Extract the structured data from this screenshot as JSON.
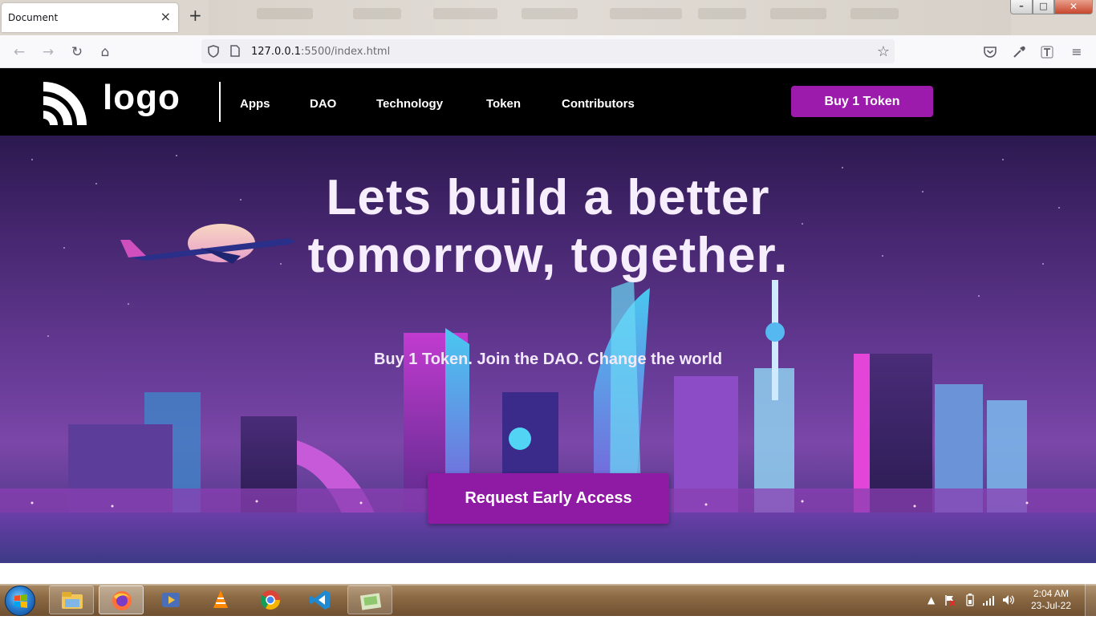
{
  "browser": {
    "tab_title": "Document",
    "tab_close": "×",
    "new_tab": "+",
    "url_host": "127.0.0.1",
    "url_rest": ":5500/index.html",
    "back": "←",
    "forward": "→",
    "reload": "↻",
    "home": "⌂",
    "star": "☆",
    "pocket": "♡",
    "menu": "≡",
    "window_min": "–",
    "window_max": "□",
    "window_close": "✕"
  },
  "site": {
    "logo_text": "logo",
    "nav": [
      "Apps",
      "DAO",
      "Technology",
      "Token",
      "Contributors"
    ],
    "buy_button": "Buy 1 Token",
    "hero_title_1": "Lets build a better",
    "hero_title_2": "tomorrow, together.",
    "hero_subtitle": "Buy 1 Token. Join the DAO. Change the world",
    "cta_button": "Request Early Access",
    "colors": {
      "accent": "#9c1bac",
      "header_bg": "#000000"
    }
  },
  "taskbar": {
    "time": "2:04 AM",
    "date": "23-Jul-22",
    "apps": [
      "file-explorer-icon",
      "firefox-icon",
      "media-player-icon",
      "vlc-icon",
      "chrome-icon",
      "vscode-icon",
      "app-icon"
    ]
  }
}
